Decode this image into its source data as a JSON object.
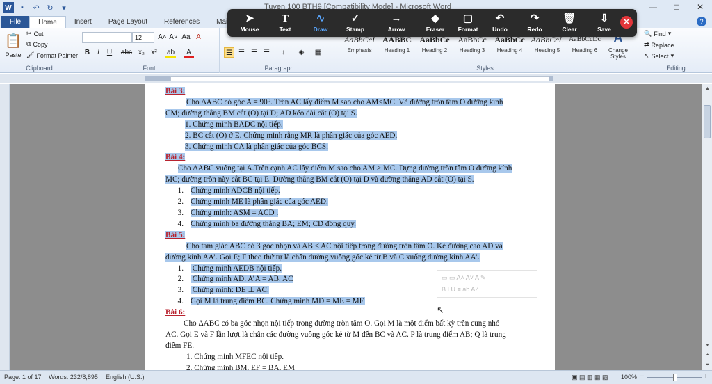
{
  "window": {
    "title": "Tuyen 100 BTH9 [Compatibility Mode] - Microsoft Word",
    "app_badge": "W",
    "controls": [
      "—",
      "□",
      "✕"
    ]
  },
  "tabs": [
    "File",
    "Home",
    "Insert",
    "Page Layout",
    "References",
    "Mailings"
  ],
  "help": "?",
  "clipboard": {
    "cut": "Cut",
    "copy": "Copy",
    "format_painter": "Format Painter",
    "paste": "Paste",
    "label": "Clipboard"
  },
  "font": {
    "name": "",
    "size": "12",
    "label": "Font",
    "grow": "A˄",
    "shrink": "A˅",
    "aa": "Aa",
    "clear": "A",
    "bold": "B",
    "italic": "I",
    "underline": "U",
    "strike": "abc",
    "sub": "x₂",
    "sup": "x²",
    "highlight": "ab",
    "color": "A"
  },
  "paragraph": {
    "label": "Paragraph"
  },
  "styles": {
    "label": "Styles",
    "items": [
      {
        "sample": "AaBbCcI",
        "name": "Emphasis"
      },
      {
        "sample": "AABBC",
        "name": "Heading 1"
      },
      {
        "sample": "AaBbCe",
        "name": "Heading 2"
      },
      {
        "sample": "AaBbCc",
        "name": "Heading 3"
      },
      {
        "sample": "AaBbCc",
        "name": "Heading 4"
      },
      {
        "sample": "AaBbCcL",
        "name": "Heading 5"
      },
      {
        "sample": "AaBbCcDc",
        "name": "Heading 6"
      }
    ],
    "change": "Change Styles"
  },
  "editing": {
    "find": "Find",
    "replace": "Replace",
    "select": "Select",
    "label": "Editing"
  },
  "draw_toolbar": {
    "tools": [
      {
        "icon": "➤",
        "label": "Mouse"
      },
      {
        "icon": "T",
        "label": "Text"
      },
      {
        "icon": "∿",
        "label": "Draw"
      },
      {
        "icon": "✓",
        "label": "Stamp"
      },
      {
        "icon": "→",
        "label": "Arrow"
      },
      {
        "icon": "◆",
        "label": "Eraser"
      },
      {
        "icon": "▢",
        "label": "Format"
      },
      {
        "icon": "↶",
        "label": "Undo"
      },
      {
        "icon": "↷",
        "label": "Redo"
      },
      {
        "icon": "🗑",
        "label": "Clear"
      },
      {
        "icon": "⇩",
        "label": "Save"
      }
    ],
    "close": "✕",
    "active_tool": "Draw",
    "active_color": "#5aa7ff"
  },
  "document": {
    "lines": [
      {
        "text": "Bài 3:",
        "kind": "head",
        "hl": true
      },
      {
        "text": "Cho ΔABC có góc A = 90⁰. Trên AC lấy điểm M sao cho AM<MC. Vẽ đường tròn tâm O đường kính",
        "indent": 30,
        "hl": true
      },
      {
        "text": "CM; đường thẳng BM cắt (O) tại D; AD kéo dài cắt (O) tại S.",
        "hl": true
      },
      {
        "text": "1. Chứng minh BADC nội tiếp.",
        "indent": 28,
        "hl": true
      },
      {
        "text": "2. BC cắt (O) ở E. Chứng minh rằng MR là phân giác của góc AED.",
        "indent": 28,
        "hl": true
      },
      {
        "text": "3. Chứng minh CA là phân giác của góc BCS.",
        "indent": 28,
        "hl": true
      },
      {
        "text": "Bài 4:",
        "kind": "head",
        "hl": true
      },
      {
        "text": "Cho ΔABC vuông tại A.Trên cạnh AC lấy điểm M sao cho AM > MC. Dựng đường tròn tâm O đường kính",
        "indent": 18,
        "hl": true
      },
      {
        "text": "MC; đường tròn này cắt BC tại E. Đường thẳng BM cắt (O) tại D và đường thẳng AD cắt (O) tại S.",
        "hl": true
      },
      {
        "num": "1.",
        "text": "Chứng minh ADCB nội tiếp.",
        "hl": true
      },
      {
        "num": "2.",
        "text": "Chứng minh ME là phân giác của góc AED.",
        "hl": true
      },
      {
        "num": "3.",
        "text": "Chứng minh:  ASM  =  ACD .",
        "hl": true
      },
      {
        "num": "4.",
        "text": "Chứng minh ba đường thẳng BA; EM; CD đồng quy.",
        "hl": true
      },
      {
        "text": "Bài 5:",
        "kind": "head",
        "hl": true
      },
      {
        "text": "Cho tam giác ABC có 3 góc nhọn và  AB < AC nội tiếp trong đường tròn tâm O. Kẻ đường cao AD và",
        "indent": 30,
        "hl": true
      },
      {
        "text": "đường kính AA’. Gọi E; F theo thứ tự là chân đường vuông góc kẻ từ B và C xuống đường kính AA’.",
        "hl": true
      },
      {
        "num": "1.",
        "text": " Chứng minh AEDB nội tiếp.",
        "hl": true
      },
      {
        "num": "2.",
        "text": " Chứng minh AD. A’A = AB. AC",
        "hl": true
      },
      {
        "num": "3.",
        "text": " Chứng minh: DE ⊥ AC.",
        "hl": true
      },
      {
        "num": "4.",
        "text": "Gọi M là trung điểm BC. Chứng minh MD = ME = MF.",
        "hl": true
      },
      {
        "text": "Bài 6:",
        "kind": "head",
        "hl": false
      },
      {
        "text": "Cho ΔABC có ba góc nhọn nội tiếp trong đường tròn tâm O. Gọi M là một điểm bất kỳ trên cung nhỏ",
        "indent": 26,
        "hl": false
      },
      {
        "text": "AC. Gọi E và F lần lượt là chân các đường vuông góc kẻ từ M đến BC và AC.  P là trung điểm AB; Q là trung",
        "hl": false
      },
      {
        "text": "điểm  FE.",
        "hl": false
      },
      {
        "text": "1. Chứng minh MFEC nội tiếp.",
        "indent": 30,
        "hl": false
      },
      {
        "text": "2. Chứng minh BM. EF = BA. EM",
        "indent": 30,
        "hl": false
      }
    ]
  },
  "status": {
    "page": "Page: 1 of 17",
    "words": "Words: 232/8,895",
    "lang": "English (U.S.)",
    "zoom": "100%",
    "minus": "−",
    "plus": "+"
  },
  "colors": {
    "selection": "#a8c8ec",
    "heading_red": "#b8232f",
    "file_tab": "#2b5797"
  }
}
